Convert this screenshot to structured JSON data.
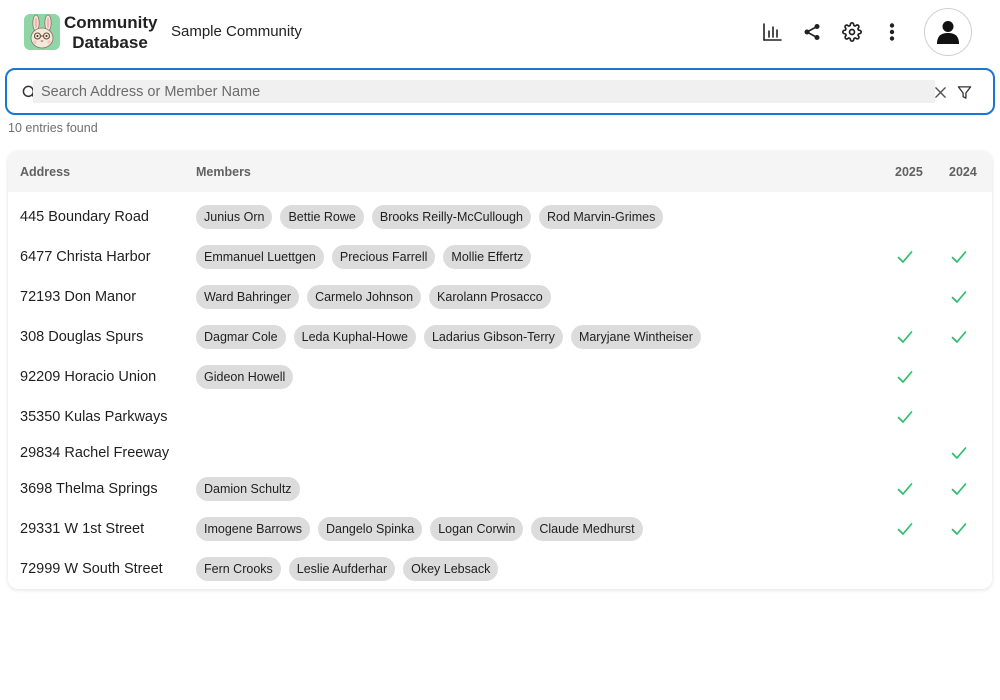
{
  "header": {
    "brand_line1": "Community",
    "brand_line2": "Database",
    "community_name": "Sample Community"
  },
  "search": {
    "placeholder": "Search Address or Member Name",
    "value": "",
    "entries_text": "10 entries found"
  },
  "table": {
    "columns": [
      "Address",
      "Members",
      "2025",
      "2024"
    ],
    "rows": [
      {
        "address": "445 Boundary Road",
        "members": [
          "Junius Orn",
          "Bettie Rowe",
          "Brooks Reilly-McCullough",
          "Rod Marvin-Grimes"
        ],
        "y2025": false,
        "y2024": false
      },
      {
        "address": "6477 Christa Harbor",
        "members": [
          "Emmanuel Luettgen",
          "Precious Farrell",
          "Mollie Effertz"
        ],
        "y2025": true,
        "y2024": true
      },
      {
        "address": "72193 Don Manor",
        "members": [
          "Ward Bahringer",
          "Carmelo Johnson",
          "Karolann Prosacco"
        ],
        "y2025": false,
        "y2024": true
      },
      {
        "address": "308 Douglas Spurs",
        "members": [
          "Dagmar Cole",
          "Leda Kuphal-Howe",
          "Ladarius Gibson-Terry",
          "Maryjane Wintheiser"
        ],
        "y2025": true,
        "y2024": true
      },
      {
        "address": "92209 Horacio Union",
        "members": [
          "Gideon Howell"
        ],
        "y2025": true,
        "y2024": false
      },
      {
        "address": "35350 Kulas Parkways",
        "members": [],
        "y2025": true,
        "y2024": false
      },
      {
        "address": "29834 Rachel Freeway",
        "members": [],
        "y2025": false,
        "y2024": true
      },
      {
        "address": "3698 Thelma Springs",
        "members": [
          "Damion Schultz"
        ],
        "y2025": true,
        "y2024": true
      },
      {
        "address": "29331 W 1st Street",
        "members": [
          "Imogene Barrows",
          "Dangelo Spinka",
          "Logan Corwin",
          "Claude Medhurst"
        ],
        "y2025": true,
        "y2024": true
      },
      {
        "address": "72999 W South Street",
        "members": [
          "Fern Crooks",
          "Leslie Aufderhar",
          "Okey Lebsack"
        ],
        "y2025": false,
        "y2024": false
      }
    ]
  },
  "colors": {
    "accent": "#1976d2",
    "check": "#2ebd6b",
    "chip_bg": "#dcdcdc"
  },
  "icons": {
    "logo": "rabbit-logo-icon",
    "stats": "bar-chart-icon",
    "share": "share-icon",
    "settings": "gear-icon",
    "menu": "more-vertical-icon",
    "avatar": "person-icon",
    "search": "search-icon",
    "clear": "close-icon",
    "filter": "filter-icon",
    "check": "check-icon"
  }
}
